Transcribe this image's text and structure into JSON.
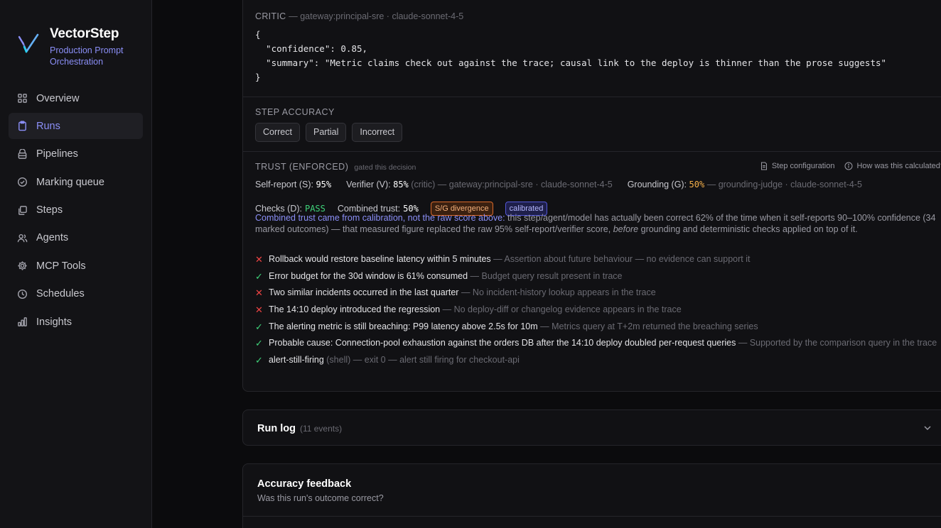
{
  "brand": {
    "name": "VectorStep",
    "subtitle": "Production Prompt Orchestration"
  },
  "nav": [
    {
      "label": "Overview",
      "icon": "grid-icon"
    },
    {
      "label": "Runs",
      "icon": "clipboard-icon",
      "active": true
    },
    {
      "label": "Pipelines",
      "icon": "layers-icon"
    },
    {
      "label": "Marking queue",
      "icon": "check-circle-icon"
    },
    {
      "label": "Steps",
      "icon": "stack-icon"
    },
    {
      "label": "Agents",
      "icon": "users-icon"
    },
    {
      "label": "MCP Tools",
      "icon": "gear-icon"
    },
    {
      "label": "Schedules",
      "icon": "clock-icon"
    },
    {
      "label": "Insights",
      "icon": "bar-chart-icon"
    }
  ],
  "critic": {
    "label": "CRITIC",
    "source": "— gateway:principal-sre · claude-sonnet-4-5",
    "json_lines": [
      "{",
      "  \"confidence\": 0.85,",
      "  \"summary\": \"Metric claims check out against the trace; causal link to the deploy is thinner than the prose suggests\"",
      "}"
    ]
  },
  "step_accuracy": {
    "label": "STEP ACCURACY",
    "buttons": [
      "Correct",
      "Partial",
      "Incorrect"
    ]
  },
  "trust": {
    "label": "TRUST (ENFORCED)",
    "gated": "gated this decision",
    "link_config": "Step configuration",
    "link_calc": "How was this calculated?",
    "self_report_label": "Self-report (S):",
    "self_report_value": "95%",
    "verifier_label": "Verifier (V):",
    "verifier_value": "85%",
    "verifier_source": "(critic) — gateway:principal-sre · claude-sonnet-4-5",
    "grounding_label": "Grounding (G):",
    "grounding_value": "50%",
    "grounding_source": "— grounding-judge · claude-sonnet-4-5",
    "checks_label": "Checks (D):",
    "checks_value": "PASS",
    "combined_label": "Combined trust:",
    "combined_value": "50%",
    "badge_divergence": "S/G divergence",
    "badge_calibrated": "calibrated",
    "explain_link": "Combined trust came from calibration, not the raw score above:",
    "explain_text_1": " this step/agent/model has actually been correct 62% of the time when it self-reports 90–100% confidence (34 marked outcomes) — that measured figure replaced the raw 95% self-report/verifier score, ",
    "explain_em": "before",
    "explain_text_2": " grounding and deterministic checks applied on top of it.",
    "claims": [
      {
        "status": "fail",
        "text": "Rollback would restore baseline latency within 5 minutes",
        "note": " — Assertion about future behaviour — no evidence can support it"
      },
      {
        "status": "pass",
        "text": "Error budget for the 30d window is 61% consumed",
        "note": " — Budget query result present in trace"
      },
      {
        "status": "fail",
        "text": "Two similar incidents occurred in the last quarter",
        "note": " — No incident-history lookup appears in the trace"
      },
      {
        "status": "fail",
        "text": "The 14:10 deploy introduced the regression",
        "note": " — No deploy-diff or changelog evidence appears in the trace"
      },
      {
        "status": "pass",
        "text": "The alerting metric is still breaching: P99 latency above 2.5s for 10m",
        "note": " — Metrics query at T+2m returned the breaching series"
      },
      {
        "status": "pass",
        "text": "Probable cause: Connection-pool exhaustion against the orders DB after the 14:10 deploy doubled per-request queries",
        "note": " — Supported by the comparison query in the trace"
      },
      {
        "status": "pass",
        "text": "alert-still-firing",
        "note": " (shell) — exit 0 — alert still firing for checkout-api"
      }
    ]
  },
  "run_log": {
    "title": "Run log",
    "count": "(11 events)"
  },
  "feedback": {
    "title": "Accuracy feedback",
    "subtitle": "Was this run's outcome correct?"
  }
}
